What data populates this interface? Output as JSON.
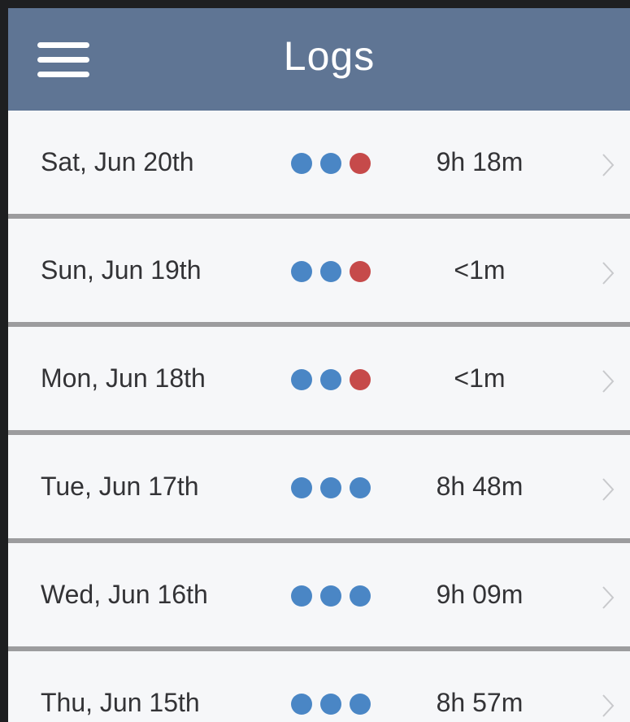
{
  "header": {
    "title": "Logs",
    "menu_icon": "hamburger-menu-icon"
  },
  "colors": {
    "header_bg": "#5f7594",
    "dot_blue": "#4a86c5",
    "dot_red": "#c64a4a",
    "divider": "#9c9c9e",
    "row_bg": "#f6f7f9",
    "text": "#333336"
  },
  "logs": [
    {
      "date": "Sat, Jun 20th",
      "dots": [
        "blue",
        "blue",
        "red"
      ],
      "duration": "9h 18m"
    },
    {
      "date": "Sun, Jun 19th",
      "dots": [
        "blue",
        "blue",
        "red"
      ],
      "duration": "<1m"
    },
    {
      "date": "Mon, Jun 18th",
      "dots": [
        "blue",
        "blue",
        "red"
      ],
      "duration": "<1m"
    },
    {
      "date": "Tue, Jun 17th",
      "dots": [
        "blue",
        "blue",
        "blue"
      ],
      "duration": "8h 48m"
    },
    {
      "date": "Wed, Jun 16th",
      "dots": [
        "blue",
        "blue",
        "blue"
      ],
      "duration": "9h 09m"
    },
    {
      "date": "Thu, Jun 15th",
      "dots": [
        "blue",
        "blue",
        "blue"
      ],
      "duration": "8h 57m"
    }
  ]
}
